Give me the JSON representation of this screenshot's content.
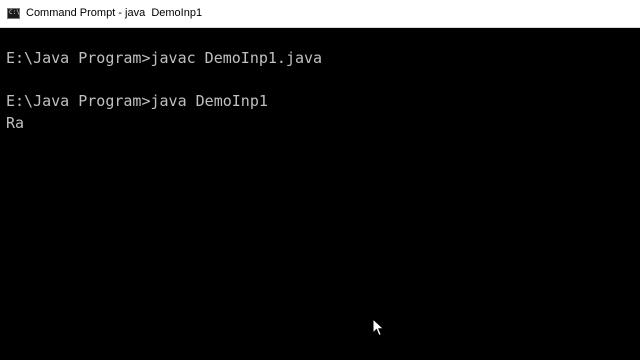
{
  "window": {
    "title": "Command Prompt - java  DemoInp1",
    "icon": "command-prompt-icon"
  },
  "console": {
    "lines": [
      "E:\\Java Program>javac DemoInp1.java",
      "E:\\Java Program>java DemoInp1",
      "Ra"
    ]
  },
  "colors": {
    "background": "#000000",
    "text": "#c0c0c0",
    "titlebar": "#ffffff"
  }
}
